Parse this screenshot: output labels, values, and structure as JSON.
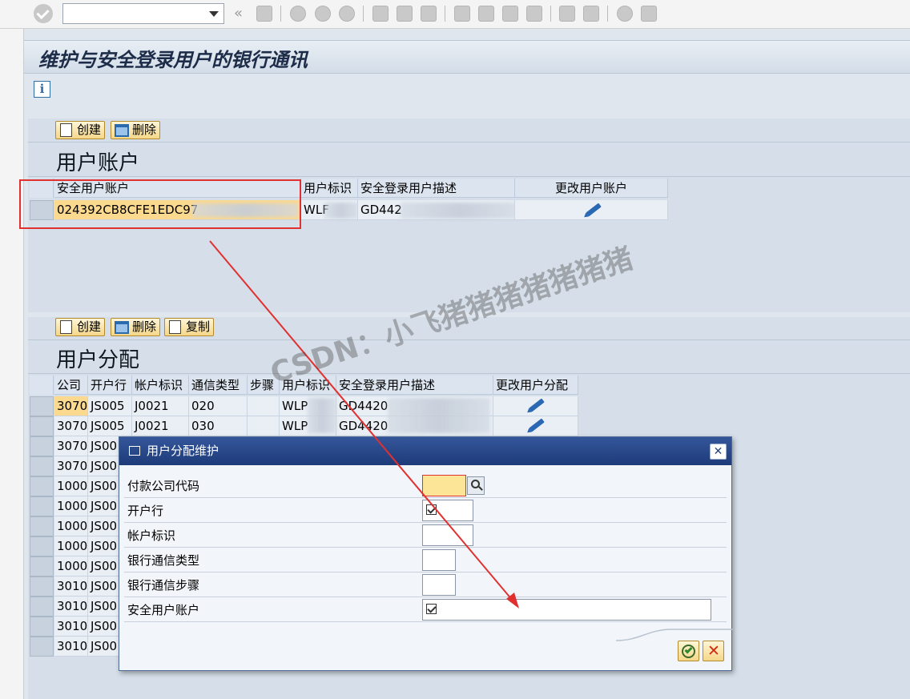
{
  "window": {
    "title": "维护与安全登录用户的银行通讯"
  },
  "toolbar": {
    "command_field_value": "",
    "back_glyph": "«"
  },
  "section1": {
    "title": "用户账户",
    "buttons": {
      "create": "创建",
      "delete": "删除"
    },
    "columns": [
      "安全用户账户",
      "用户标识",
      "安全登录用户描述",
      "更改用户账户"
    ],
    "rows": [
      {
        "account": "024392CB8CFE1EDC97",
        "user_id": "WLF",
        "description": "GD442"
      }
    ]
  },
  "section2": {
    "title": "用户分配",
    "buttons": {
      "create": "创建",
      "delete": "删除",
      "copy": "复制"
    },
    "columns": [
      "公司",
      "开户行",
      "帐户标识",
      "通信类型",
      "步骤",
      "用户标识",
      "安全登录用户描述",
      "更改用户分配"
    ],
    "rows": [
      {
        "company": "3070",
        "bank": "JS005",
        "account_id": "J0021",
        "comm_type": "020",
        "step": "",
        "user_id": "WLP",
        "desc": "GD4420"
      },
      {
        "company": "3070",
        "bank": "JS005",
        "account_id": "J0021",
        "comm_type": "030",
        "step": "",
        "user_id": "WLP",
        "desc": "GD4420"
      },
      {
        "company": "3070",
        "bank": "JS00"
      },
      {
        "company": "3070",
        "bank": "JS00"
      },
      {
        "company": "1000",
        "bank": "JS00"
      },
      {
        "company": "1000",
        "bank": "JS00"
      },
      {
        "company": "1000",
        "bank": "JS00"
      },
      {
        "company": "1000",
        "bank": "JS00"
      },
      {
        "company": "1000",
        "bank": "JS00"
      },
      {
        "company": "3010",
        "bank": "JS00"
      },
      {
        "company": "3010",
        "bank": "JS00"
      },
      {
        "company": "3010",
        "bank": "JS00"
      },
      {
        "company": "3010",
        "bank": "JS00"
      }
    ]
  },
  "dialog": {
    "title": "用户分配维护",
    "close_glyph": "✕",
    "fields": [
      {
        "label": "付款公司代码",
        "value": ""
      },
      {
        "label": "开户行",
        "value": ""
      },
      {
        "label": "帐户标识",
        "value": ""
      },
      {
        "label": "银行通信类型",
        "value": ""
      },
      {
        "label": "银行通信步骤",
        "value": ""
      },
      {
        "label": "安全用户账户",
        "value": ""
      }
    ]
  },
  "watermark": "CSDN：小飞猪猪猪猪猪猪猪",
  "colors": {
    "annotation_red": "#e03030",
    "header_blue": "#1e3b79",
    "highlight": "#fbd98f"
  }
}
